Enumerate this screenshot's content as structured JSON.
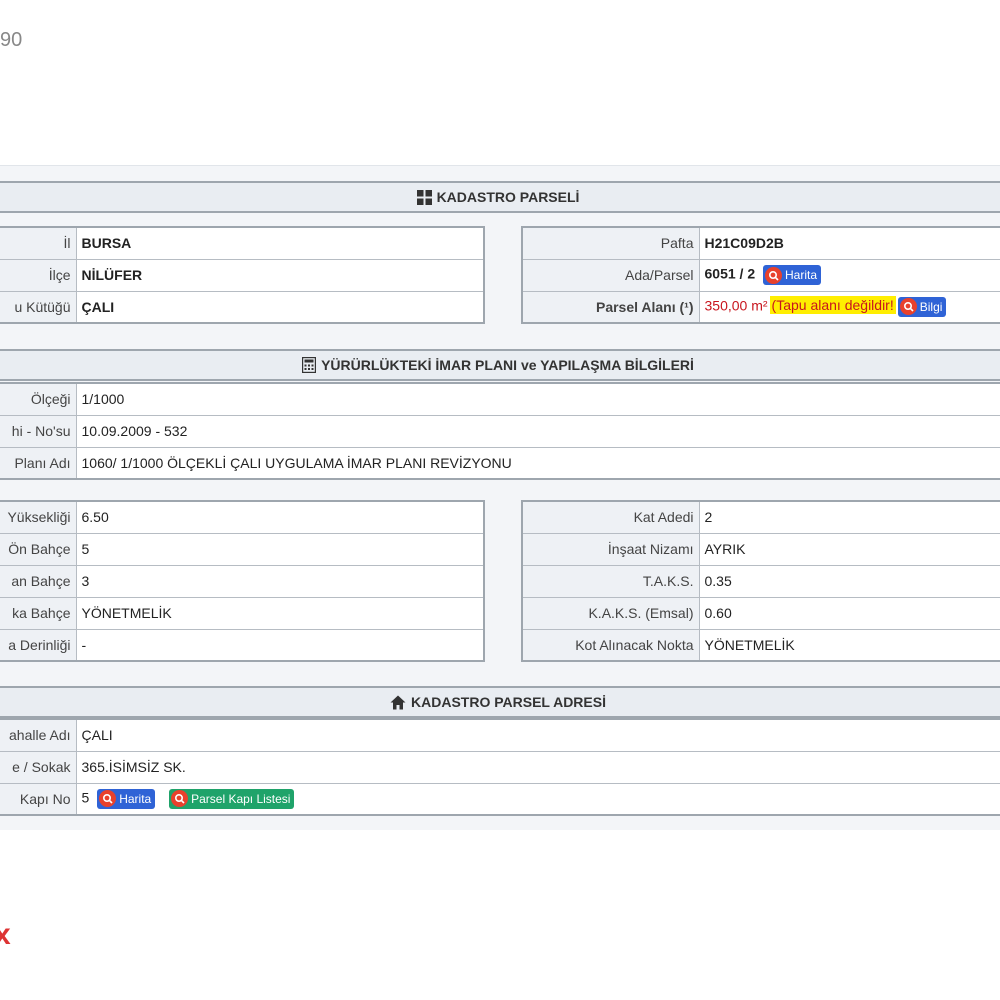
{
  "top_fragment": "90",
  "bottom_fragment": "x",
  "cadastre": {
    "header": "KADASTRO PARSELİ",
    "left": [
      {
        "label": "İl",
        "value": "BURSA"
      },
      {
        "label": "İlçe",
        "value": "NİLÜFER"
      },
      {
        "label": "u Kütüğü",
        "value": "ÇALI"
      }
    ],
    "pafta_label": "Pafta",
    "pafta_value": "H21C09D2B",
    "ada_label": "Ada/Parsel",
    "ada_value": "6051 / 2",
    "map_button": "Harita",
    "area_label": "Parsel Alanı (¹)",
    "area_value": "350,00 m²",
    "area_warning": "(Tapu alanı değildir!",
    "info_button": "Bilgi"
  },
  "zoning": {
    "header": "YÜRÜRLÜKTEKİ İMAR PLANI ve YAPILAŞMA BİLGİLERİ",
    "plan_rows": [
      {
        "label": "Ölçeği",
        "value": "1/1000"
      },
      {
        "label": "hi - No'su",
        "value": "10.09.2009 - 532"
      },
      {
        "label": "Planı Adı",
        "value": "1060/ 1/1000 ÖLÇEKLİ ÇALI UYGULAMA İMAR PLANI REVİZYONU"
      }
    ],
    "left": [
      {
        "label": "Yüksekliği",
        "value": "6.50"
      },
      {
        "label": "Ön Bahçe",
        "value": "5"
      },
      {
        "label": "an Bahçe",
        "value": "3"
      },
      {
        "label": "ka Bahçe",
        "value": "YÖNETMELİK"
      },
      {
        "label": "a Derinliği",
        "value": "-"
      }
    ],
    "right": [
      {
        "label": "Kat Adedi",
        "value": "2"
      },
      {
        "label": "İnşaat Nizamı",
        "value": "AYRIK"
      },
      {
        "label": "T.A.K.S.",
        "value": "0.35"
      },
      {
        "label": "K.A.K.S. (Emsal)",
        "value": "0.60"
      },
      {
        "label": "Kot Alınacak Nokta",
        "value": "YÖNETMELİK"
      }
    ]
  },
  "address": {
    "header": "KADASTRO PARSEL ADRESİ",
    "rows": [
      {
        "label": "ahalle Adı",
        "value": "ÇALI"
      },
      {
        "label": "e / Sokak",
        "value": "365.İSİMSİZ SK."
      }
    ],
    "door_label": "Kapı No",
    "door_value": "5",
    "map_button": "Harita",
    "list_button": "Parsel Kapı Listesi"
  }
}
